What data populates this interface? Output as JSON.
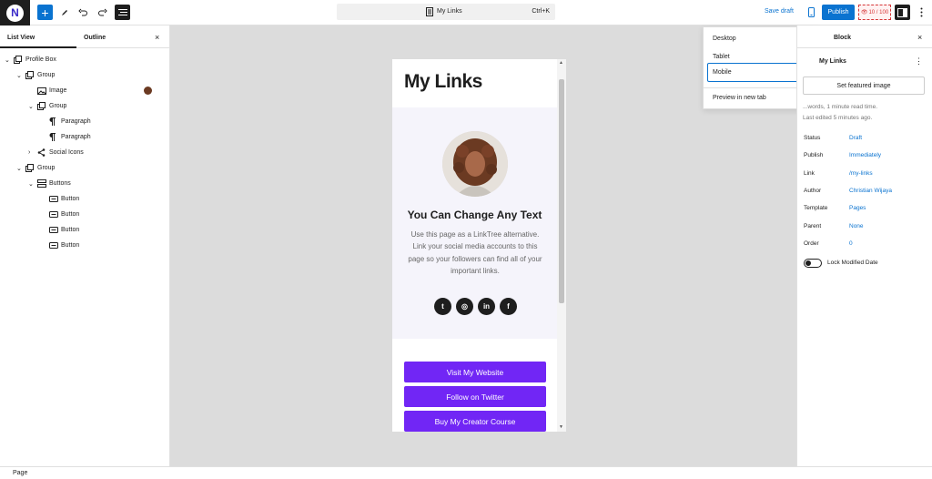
{
  "topbar": {
    "logo_letter": "N",
    "add_symbol": "+",
    "command": {
      "title": "My Links",
      "shortcut": "Ctrl+K"
    },
    "save_draft": "Save draft",
    "publish": "Publish",
    "seo_score": "10 / 100"
  },
  "left_panel": {
    "tabs": [
      "List View",
      "Outline"
    ],
    "close": "×",
    "tree": [
      {
        "label": "Profile Box",
        "icon": "cover-icon",
        "expanded": true,
        "chevron": "⌄"
      },
      {
        "label": "Group",
        "icon": "group-icon",
        "expanded": true,
        "chevron": "⌄"
      },
      {
        "label": "Image",
        "icon": "image-icon",
        "chevron": ""
      },
      {
        "label": "Group",
        "icon": "group-icon",
        "expanded": true,
        "chevron": "⌄"
      },
      {
        "label": "Paragraph",
        "icon": "paragraph-icon",
        "chevron": ""
      },
      {
        "label": "Paragraph",
        "icon": "paragraph-icon",
        "chevron": ""
      },
      {
        "label": "Social Icons",
        "icon": "share-icon",
        "expanded": false,
        "chevron": "›"
      },
      {
        "label": "Group",
        "icon": "group-icon",
        "expanded": true,
        "chevron": "⌄"
      },
      {
        "label": "Buttons",
        "icon": "buttons-icon",
        "expanded": true,
        "chevron": "⌄"
      },
      {
        "label": "Button",
        "icon": "button-icon",
        "chevron": ""
      },
      {
        "label": "Button",
        "icon": "button-icon",
        "chevron": ""
      },
      {
        "label": "Button",
        "icon": "button-icon",
        "chevron": ""
      },
      {
        "label": "Button",
        "icon": "button-icon",
        "chevron": ""
      }
    ]
  },
  "preview": {
    "heading": "My Links",
    "profile_title": "You Can Change Any Text",
    "profile_desc": "Use this page as a LinkTree alternative. Link your social media accounts to this page so your followers can find all of your important links.",
    "social": [
      {
        "name": "twitter",
        "glyph": "t"
      },
      {
        "name": "dribbble",
        "glyph": "◎"
      },
      {
        "name": "linkedin",
        "glyph": "in"
      },
      {
        "name": "facebook",
        "glyph": "f"
      }
    ],
    "buttons": [
      "Visit My Website",
      "Follow on Twitter",
      "Buy My Creator Course"
    ],
    "accent": "#7126f5"
  },
  "preview_menu": {
    "items": [
      "Desktop",
      "Tablet",
      "Mobile"
    ],
    "selected": "Mobile",
    "check": "✓",
    "new_tab": "Preview in new tab"
  },
  "right_panel": {
    "tab": "Block",
    "close": "×",
    "post_title": "My Links",
    "more": "⋮",
    "featured": "Set featured image",
    "read_time": "...words, 1 minute read time.",
    "last_edited": "Last edited 5 minutes ago.",
    "fields": [
      {
        "label": "Status",
        "value": "Draft"
      },
      {
        "label": "Publish",
        "value": "Immediately"
      },
      {
        "label": "Link",
        "value": "/my-links"
      },
      {
        "label": "Author",
        "value": "Christian Wijaya"
      },
      {
        "label": "Template",
        "value": "Pages"
      },
      {
        "label": "Parent",
        "value": "None"
      },
      {
        "label": "Order",
        "value": "0"
      }
    ],
    "toggle_label": "Lock Modified Date"
  },
  "footer": {
    "breadcrumb": "Page"
  }
}
